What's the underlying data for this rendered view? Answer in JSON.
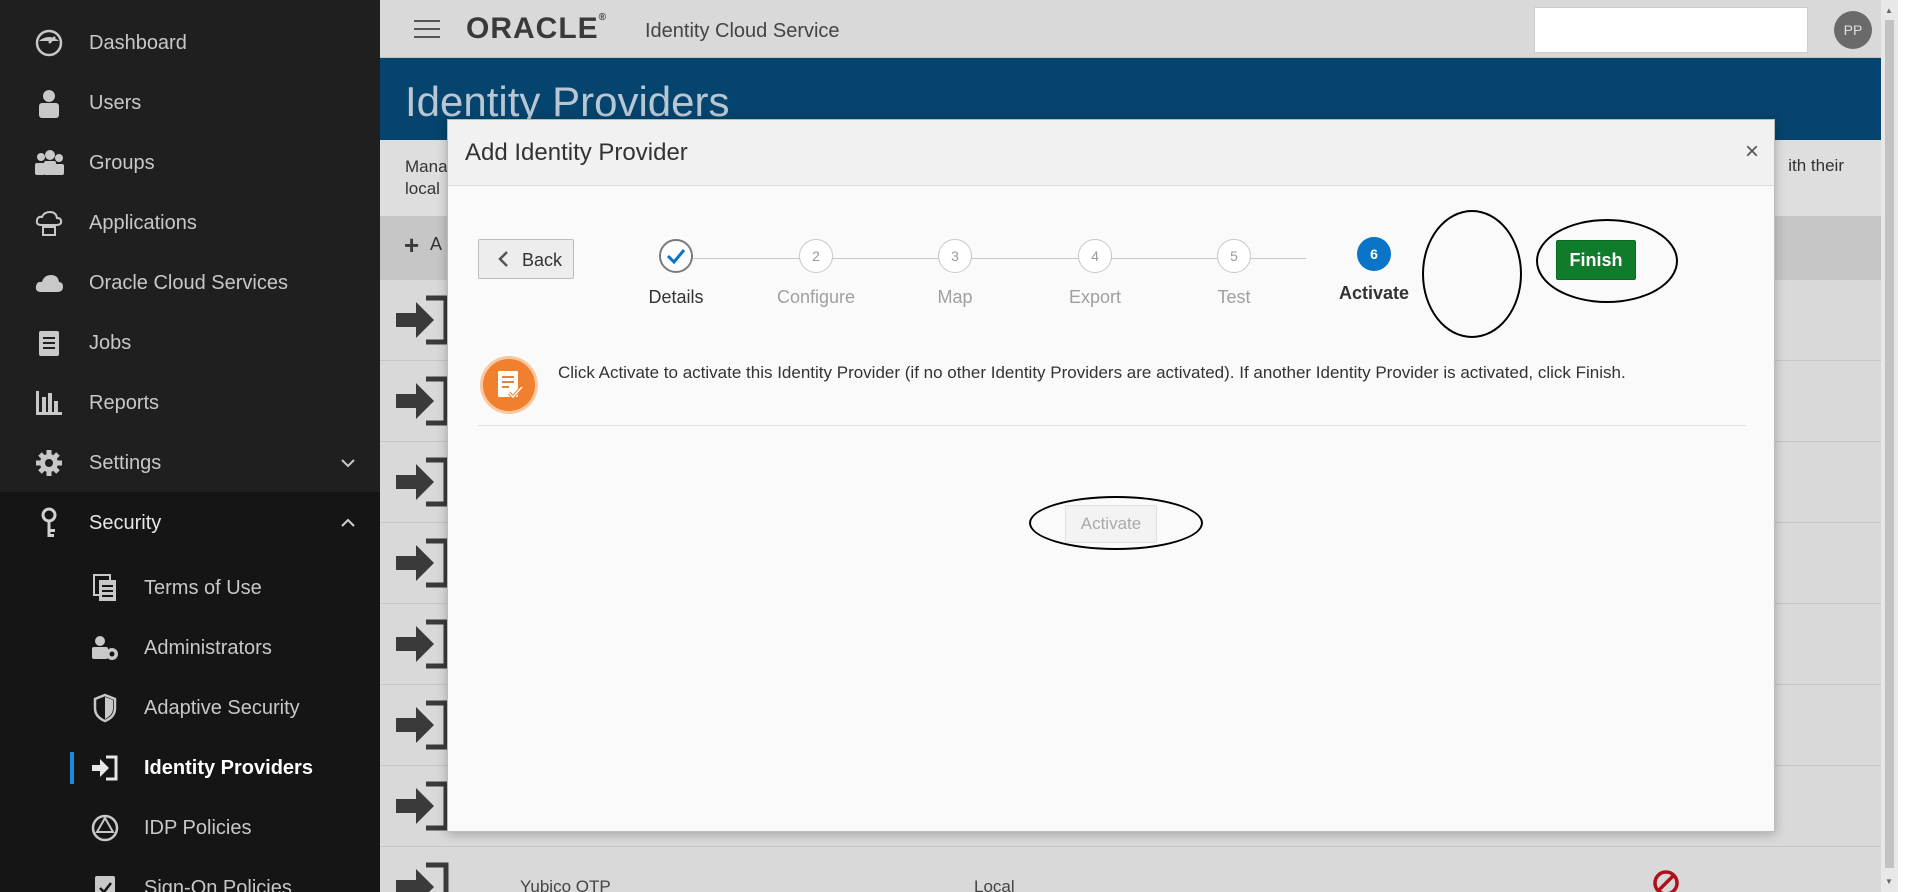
{
  "sidebar": {
    "items": [
      {
        "label": "Dashboard",
        "icon": "dashboard-icon"
      },
      {
        "label": "Users",
        "icon": "user-icon"
      },
      {
        "label": "Groups",
        "icon": "groups-icon"
      },
      {
        "label": "Applications",
        "icon": "cloud-apps-icon"
      },
      {
        "label": "Oracle Cloud Services",
        "icon": "cloud-icon"
      },
      {
        "label": "Jobs",
        "icon": "jobs-icon"
      },
      {
        "label": "Reports",
        "icon": "bar-chart-icon"
      },
      {
        "label": "Settings",
        "icon": "gear-icon"
      },
      {
        "label": "Security",
        "icon": "key-icon"
      }
    ],
    "security_subitems": [
      {
        "label": "Terms of Use",
        "icon": "documents-icon"
      },
      {
        "label": "Administrators",
        "icon": "admin-icon"
      },
      {
        "label": "Adaptive Security",
        "icon": "shield-icon"
      },
      {
        "label": "Identity Providers",
        "icon": "sign-in-icon"
      },
      {
        "label": "IDP Policies",
        "icon": "idp-policy-icon"
      },
      {
        "label": "Sign-On Policies",
        "icon": "sign-on-policy-icon"
      }
    ]
  },
  "header": {
    "logo": "ORACLE",
    "product": "Identity Cloud Service",
    "avatar_initials": "PP"
  },
  "page": {
    "title": "Identity Providers",
    "description_left_1": "Mana",
    "description_left_2": "local",
    "description_right": "ith their",
    "toolbar_add_label": "A",
    "last_row": {
      "name": "Yubico OTP",
      "type": "Local"
    }
  },
  "modal": {
    "title": "Add Identity Provider",
    "close": "×",
    "back_label": "Back",
    "finish_label": "Finish",
    "steps": [
      {
        "number": "",
        "label": "Details",
        "state": "done"
      },
      {
        "number": "2",
        "label": "Configure",
        "state": "pending"
      },
      {
        "number": "3",
        "label": "Map",
        "state": "pending"
      },
      {
        "number": "4",
        "label": "Export",
        "state": "pending"
      },
      {
        "number": "5",
        "label": "Test",
        "state": "pending"
      },
      {
        "number": "6",
        "label": "Activate",
        "state": "current"
      }
    ],
    "info_text": "Click Activate to activate this Identity Provider (if no other Identity Providers are activated). If another Identity Provider is activated, click Finish.",
    "activate_label": "Activate"
  },
  "colors": {
    "sidebar_bg": "#1f1f1f",
    "banner_bg": "#04446e",
    "finish_green": "#0f7b2b",
    "step_current_blue": "#0a74c8",
    "info_orange": "#f07f2e"
  }
}
